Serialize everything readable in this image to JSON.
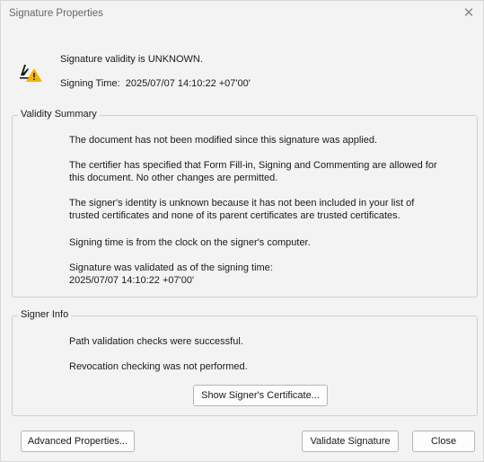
{
  "window": {
    "title": "Signature Properties",
    "close_glyph": "✕"
  },
  "header": {
    "icon": "signature-warning-icon",
    "validity_status": "Signature validity is UNKNOWN.",
    "signing_time": "Signing Time:  2025/07/07 14:10:22 +07'00'"
  },
  "validity_summary": {
    "label": "Validity Summary",
    "lines": [
      "The document has not been modified since this signature was applied.",
      "The certifier has specified that Form Fill-in, Signing and Commenting are allowed for",
      "this document. No other changes are permitted.",
      "The signer's identity is unknown because it has not been included in your list of",
      "trusted certificates and none of its parent certificates are trusted certificates.",
      "Signing time is from the clock on the signer's computer.",
      "Signature was validated as of the signing time:",
      "2025/07/07 14:10:22 +07'00'"
    ]
  },
  "signer_info": {
    "label": "Signer Info",
    "lines": [
      "Path validation checks were successful.",
      "Revocation checking was not performed."
    ],
    "show_cert_button": "Show Signer's Certificate..."
  },
  "footer": {
    "advanced_button": "Advanced Properties...",
    "validate_button": "Validate Signature",
    "close_button": "Close"
  },
  "colors": {
    "dialog_background": "#f3f3f3",
    "warning_yellow": "#f5b400",
    "group_border": "#cfcfcf"
  }
}
